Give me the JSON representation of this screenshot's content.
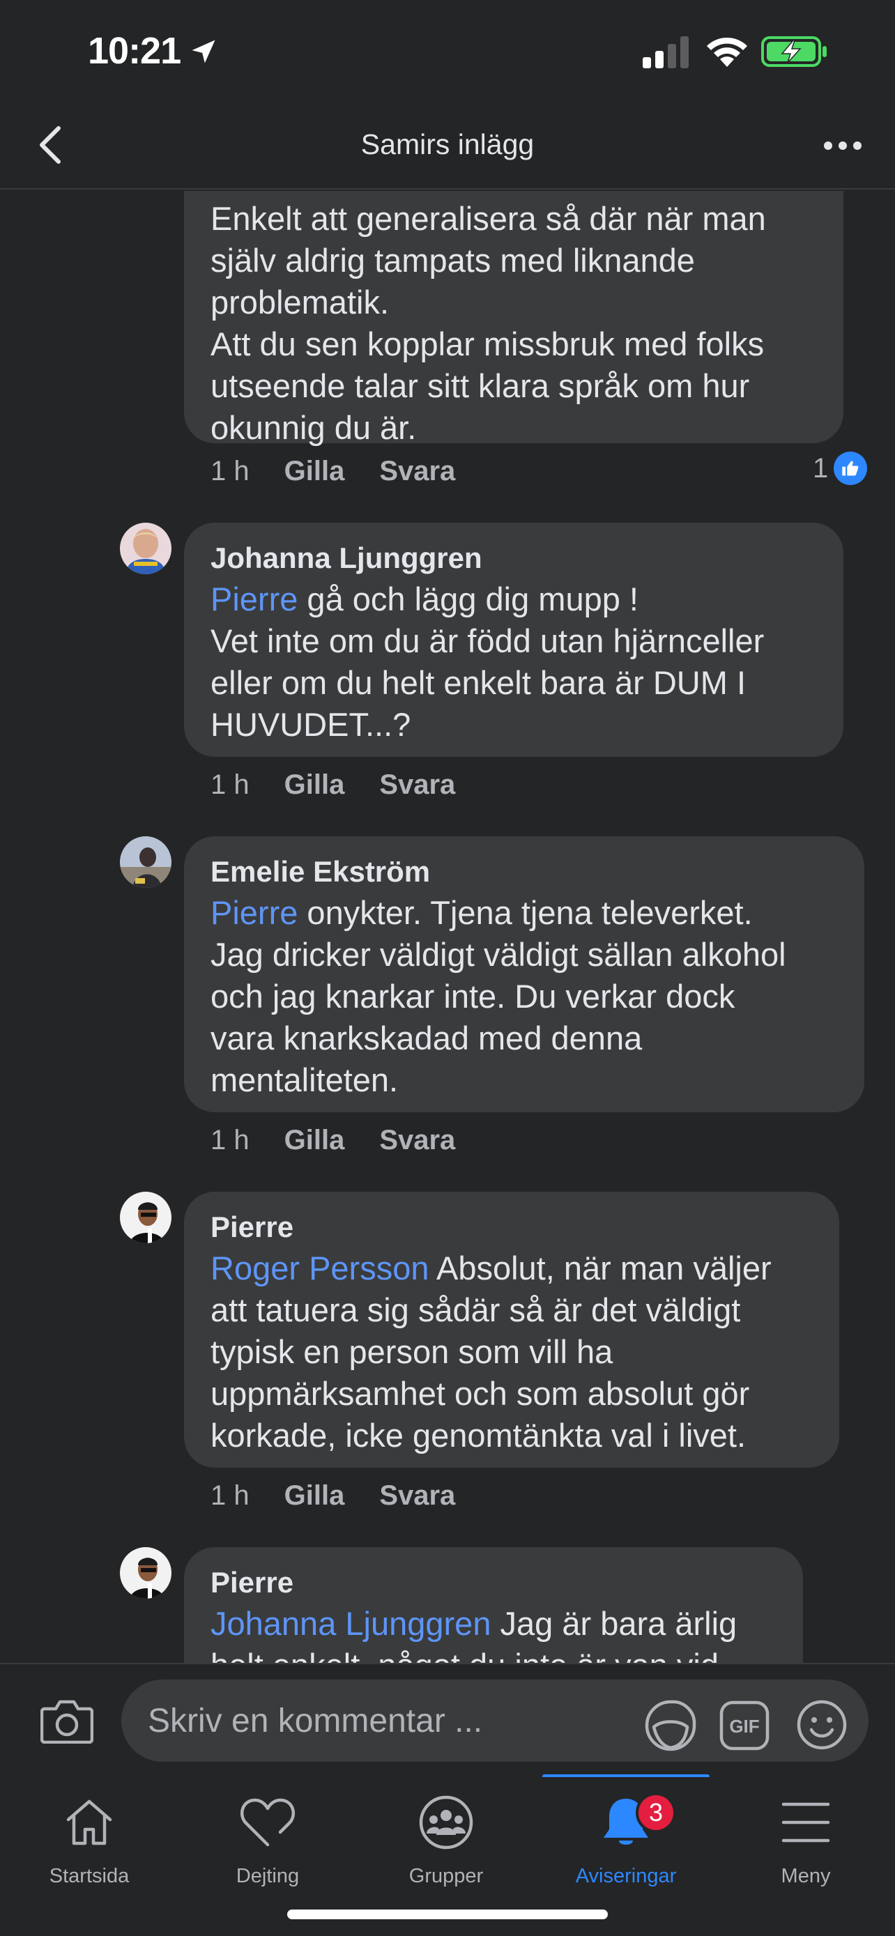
{
  "status_bar": {
    "time": "10:21"
  },
  "header": {
    "title": "Samirs inlägg"
  },
  "comments": [
    {
      "author": "",
      "text": "Enkelt att generalisera så där när man\nsjälv aldrig tampats med liknande\nproblematik.\nAtt du sen kopplar missbruk med folks\nutseende talar sitt klara språk om hur\nokunnig du är.",
      "mention": "",
      "time": "1 h",
      "like_label": "Gilla",
      "reply_label": "Svara",
      "like_count": "1"
    },
    {
      "author": "Johanna Ljunggren",
      "mention": "Pierre",
      "text": " gå och lägg dig mupp !\nVet inte om du är född utan hjärnceller\neller om du helt enkelt bara är DUM I\nHUVUDET...?",
      "time": "1 h",
      "like_label": "Gilla",
      "reply_label": "Svara"
    },
    {
      "author": "Emelie Ekström",
      "mention": "Pierre",
      "text": " onykter. Tjena tjena televerket.\nJag dricker väldigt väldigt sällan alkohol\noch jag knarkar inte. Du verkar dock\nvara knarkskadad med denna\nmentaliteten.",
      "time": "1 h",
      "like_label": "Gilla",
      "reply_label": "Svara"
    },
    {
      "author": "Pierre",
      "mention": "Roger Persson",
      "text": " Absolut, när man väljer\natt tatuera sig sådär så är det väldigt\ntypisk en person som vill ha\nuppmärksamhet och som absolut gör\nkorkade, icke genomtänkta val i livet.",
      "time": "1 h",
      "like_label": "Gilla",
      "reply_label": "Svara"
    },
    {
      "author": "Pierre",
      "mention": "Johanna Ljunggren",
      "text": " Jag är bara ärlig\nhelt enkelt, något du inte är van vid",
      "time": "",
      "like_label": "",
      "reply_label": ""
    }
  ],
  "composer": {
    "placeholder": "Skriv en kommentar ..."
  },
  "tabs": [
    {
      "label": "Startsida",
      "icon": "home-icon"
    },
    {
      "label": "Dejting",
      "icon": "heart-icon"
    },
    {
      "label": "Grupper",
      "icon": "groups-icon"
    },
    {
      "label": "Aviseringar",
      "icon": "bell-icon",
      "badge": "3",
      "active": true
    },
    {
      "label": "Meny",
      "icon": "menu-icon"
    }
  ],
  "colors": {
    "accent": "#2d88ff",
    "mention": "#5e95f7",
    "bubble": "#3a3b3c",
    "background": "#242526",
    "badge": "#e41e3f"
  }
}
